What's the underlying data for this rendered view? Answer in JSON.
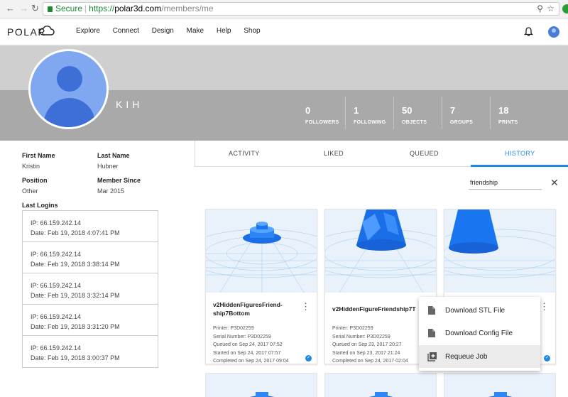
{
  "browser": {
    "secure_label": "Secure",
    "url_scheme": "https://",
    "url_host": "polar3d.com",
    "url_path": "/members/me"
  },
  "nav": {
    "logo": "POLAR",
    "items": [
      "Explore",
      "Connect",
      "Design",
      "Make",
      "Help",
      "Shop"
    ]
  },
  "profile": {
    "username": "KIH",
    "stats": [
      {
        "value": "0",
        "label": "FOLLOWERS"
      },
      {
        "value": "1",
        "label": "FOLLOWING"
      },
      {
        "value": "50",
        "label": "OBJECTS"
      },
      {
        "value": "7",
        "label": "GROUPS"
      },
      {
        "value": "18",
        "label": "PRINTS"
      }
    ],
    "fields": {
      "first_name_label": "First Name",
      "first_name": "Kristin",
      "last_name_label": "Last Name",
      "last_name": "Hubner",
      "position_label": "Position",
      "position": "Other",
      "member_since_label": "Member Since",
      "member_since": "Mar 2015"
    },
    "last_logins_label": "Last Logins",
    "logins": [
      {
        "ip": "IP: 66.159.242.14",
        "date": "Date: Feb 19, 2018 4:07:41 PM"
      },
      {
        "ip": "IP: 66.159.242.14",
        "date": "Date: Feb 19, 2018 3:38:14 PM"
      },
      {
        "ip": "IP: 66.159.242.14",
        "date": "Date: Feb 19, 2018 3:32:14 PM"
      },
      {
        "ip": "IP: 66.159.242.14",
        "date": "Date: Feb 19, 2018 3:31:20 PM"
      },
      {
        "ip": "IP: 66.159.242.14",
        "date": "Date: Feb 19, 2018 3:00:37 PM"
      }
    ]
  },
  "tabs": [
    "ACTIVITY",
    "LIKED",
    "QUEUED",
    "HISTORY"
  ],
  "active_tab": "HISTORY",
  "search": {
    "value": "friendship"
  },
  "cards": [
    {
      "title": "v2HiddenFiguresFriend-ship7Bottom",
      "printer": "Printer: P3D02259",
      "serial": "Serial Number: P3D02259",
      "queued": "Queued on Sep 24, 2017 07:52",
      "started": "Started on Sep 24, 2017 07:57",
      "completed": "Completed on Sep 24, 2017 09:04"
    },
    {
      "title": "v2HiddenFigureFriendship7T",
      "printer": "Printer: P3D02259",
      "serial": "Serial Number: P3D02259",
      "queued": "Queued on Sep 23, 2017 20:27",
      "started": "Started on Sep 23, 2017 21:24",
      "completed": "Completed on Sep 24, 2017 02:04"
    }
  ],
  "context_menu": [
    "Download STL File",
    "Download Config File",
    "Requeue Job"
  ],
  "colors": {
    "accent": "#1e88e5",
    "model": "#1a75f0",
    "banner": "#a9a9a9"
  }
}
